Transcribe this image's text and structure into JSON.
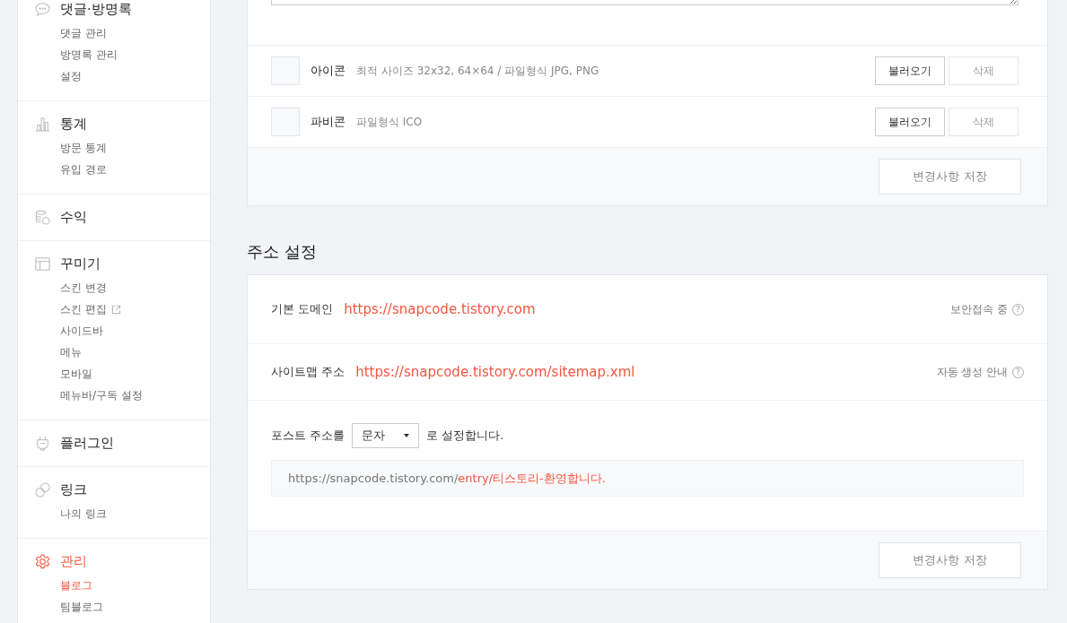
{
  "sidebar": {
    "groups": [
      {
        "kind": "comments",
        "title": "댓글·방명록",
        "selected": false,
        "items": [
          {
            "label": "댓글 관리",
            "selected": false,
            "external": false
          },
          {
            "label": "방명록 관리",
            "selected": false,
            "external": false
          },
          {
            "label": "설정",
            "selected": false,
            "external": false
          }
        ]
      },
      {
        "kind": "stats",
        "title": "통계",
        "selected": false,
        "items": [
          {
            "label": "방문 통계",
            "selected": false,
            "external": false
          },
          {
            "label": "유입 경로",
            "selected": false,
            "external": false
          }
        ]
      },
      {
        "kind": "revenue",
        "title": "수익",
        "selected": false
      },
      {
        "kind": "design",
        "title": "꾸미기",
        "selected": false,
        "items": [
          {
            "label": "스킨 변경",
            "selected": false,
            "external": false
          },
          {
            "label": "스킨 편집",
            "selected": false,
            "external": true
          },
          {
            "label": "사이드바",
            "selected": false,
            "external": false
          },
          {
            "label": "메뉴",
            "selected": false,
            "external": false
          },
          {
            "label": "모바일",
            "selected": false,
            "external": false
          },
          {
            "label": "메뉴바/구독 설정",
            "selected": false,
            "external": false
          }
        ]
      },
      {
        "kind": "plugin",
        "title": "플러그인",
        "selected": false
      },
      {
        "kind": "link",
        "title": "링크",
        "selected": false,
        "items": [
          {
            "label": "나의 링크",
            "selected": false,
            "external": false
          }
        ]
      },
      {
        "kind": "manage",
        "title": "관리",
        "selected": true,
        "items": [
          {
            "label": "블로그",
            "selected": true,
            "external": false
          },
          {
            "label": "팀블로그",
            "selected": false,
            "external": false
          }
        ]
      }
    ]
  },
  "image_card": {
    "rows": [
      {
        "label": "아이콘",
        "description": "최적 사이즈 32x32, 64×64 / 파일형식 JPG, PNG",
        "load_button": "불러오기",
        "delete_button": "삭제"
      },
      {
        "label": "파비콘",
        "description": "파일형식 ICO",
        "load_button": "불러오기",
        "delete_button": "삭제"
      }
    ],
    "save_button": "변경사항 저장"
  },
  "address_section": {
    "title": "주소 설정",
    "rows": [
      {
        "label": "기본 도메인",
        "url": "https://snapcode.tistory.com",
        "help": "보안접속 중",
        "help_icon": "?"
      },
      {
        "label": "사이트맵 주소",
        "url": "https://snapcode.tistory.com/sitemap.xml",
        "help": "자동 생성 안내",
        "help_icon": "?"
      }
    ],
    "post_address": {
      "prefix": "포스트 주소를",
      "select": "문자",
      "suffix": "로 설정합니다.",
      "preview_base": "https://snapcode.tistory.com/",
      "preview_path": "entry/티스토리-환영합니다."
    },
    "save_button": "변경사항 저장"
  }
}
